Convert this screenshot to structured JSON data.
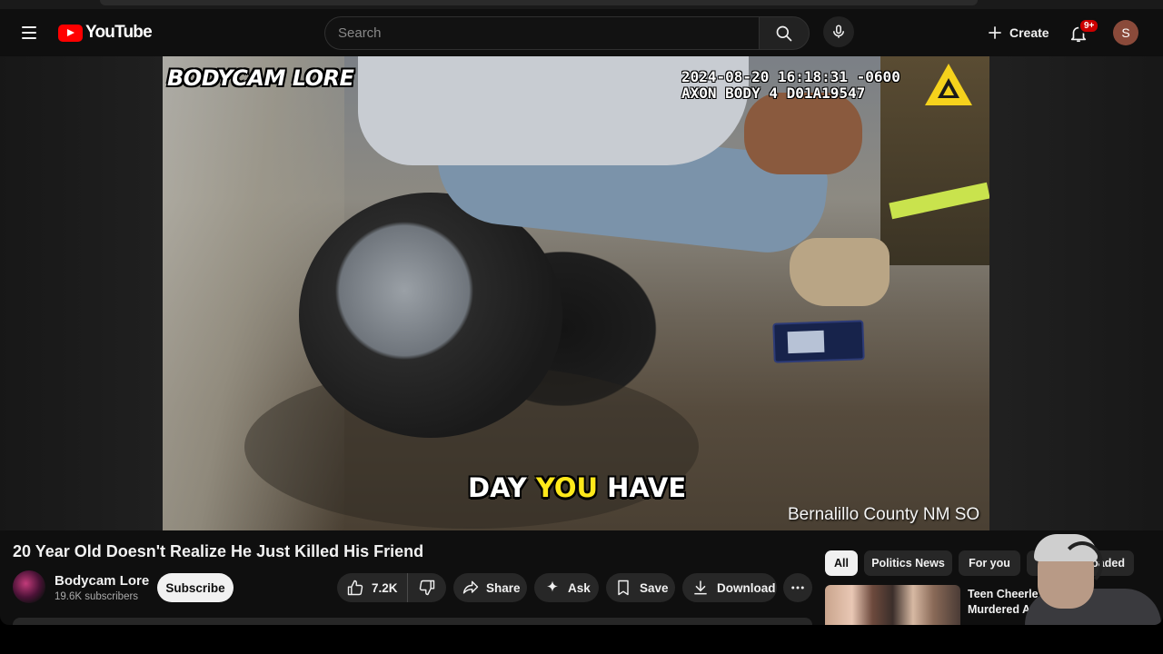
{
  "header": {
    "logo_text": "YouTube",
    "search_placeholder": "Search",
    "create_label": "Create",
    "notifications_badge": "9+",
    "avatar_letter": "S"
  },
  "video": {
    "overlay_channel_logo": "BODYCAM LORE",
    "timestamp_line1": "2024-08-20 16:18:31 -0600",
    "timestamp_line2": "AXON BODY 4 D01A19547",
    "caption_word1": "DAY",
    "caption_highlight": "YOU",
    "caption_word2": "HAVE",
    "source_credit": "Bernalillo County NM SO"
  },
  "watch": {
    "title": "20 Year Old Doesn't Realize He Just Killed His Friend",
    "channel_name": "Bodycam Lore",
    "subscribers": "19.6K subscribers",
    "subscribe_label": "Subscribe",
    "likes": "7.2K",
    "share_label": "Share",
    "ask_label": "Ask",
    "save_label": "Save",
    "download_label": "Download"
  },
  "chips": [
    "All",
    "Politics News",
    "For you",
    "loaded"
  ],
  "recommendation": {
    "title_line1": "Teen Cheerle",
    "title_line2": "Murdered A"
  },
  "colors": {
    "brand_red": "#ff0000",
    "background": "#0f0f0f",
    "pill_bg": "#272727",
    "caption_highlight": "#ffe81a"
  },
  "icons": [
    "menu-icon",
    "search-icon",
    "mic-icon",
    "plus-icon",
    "bell-icon",
    "thumbs-up-icon",
    "thumbs-down-icon",
    "share-icon",
    "sparkle-icon",
    "bookmark-icon",
    "download-icon",
    "more-icon",
    "axon-logo-icon"
  ]
}
